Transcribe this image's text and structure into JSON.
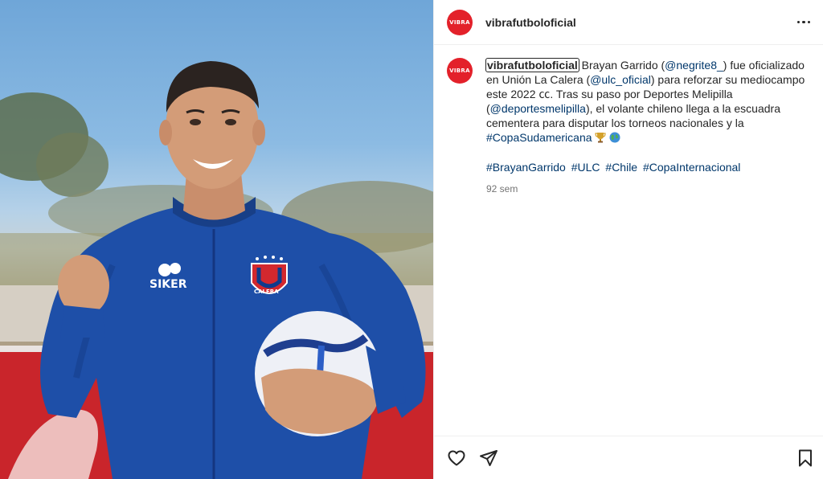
{
  "post": {
    "account": "vibrafutboloficial",
    "avatar_text": "VIBRA",
    "caption": {
      "user": "vibrafutboloficial",
      "p1": " Brayan Garrido (",
      "m1": "@negrite8_",
      "p2": ") fue oficializado en Unión La Calera (",
      "m2": "@ulc_oficial",
      "p3": ") para reforzar su mediocampo este 2022 ㏄. Tras su paso por Deportes Melipilla (",
      "m3": "@deportesmelipilla",
      "p4": "), el volante chileno llega a la escuadra cementera para disputar los torneos nacionales y la ",
      "tag_copa": "#CopaSudamericana",
      "hashtags": [
        "#BrayanGarrido",
        "#ULC",
        "#Chile",
        "#CopaInternacional"
      ]
    },
    "timestamp": "92 sem",
    "photo": {
      "jersey_brand": "SIKER",
      "crest_text": "CALERA"
    }
  },
  "icons": [
    "more-options-icon",
    "heart-icon",
    "share-icon",
    "bookmark-icon",
    "trophy-emoji",
    "globe-emoji"
  ],
  "colors": {
    "avatar_bg": "#e3212a",
    "mention": "#00376b",
    "muted": "#737373",
    "jersey": "#1e4fa8"
  }
}
